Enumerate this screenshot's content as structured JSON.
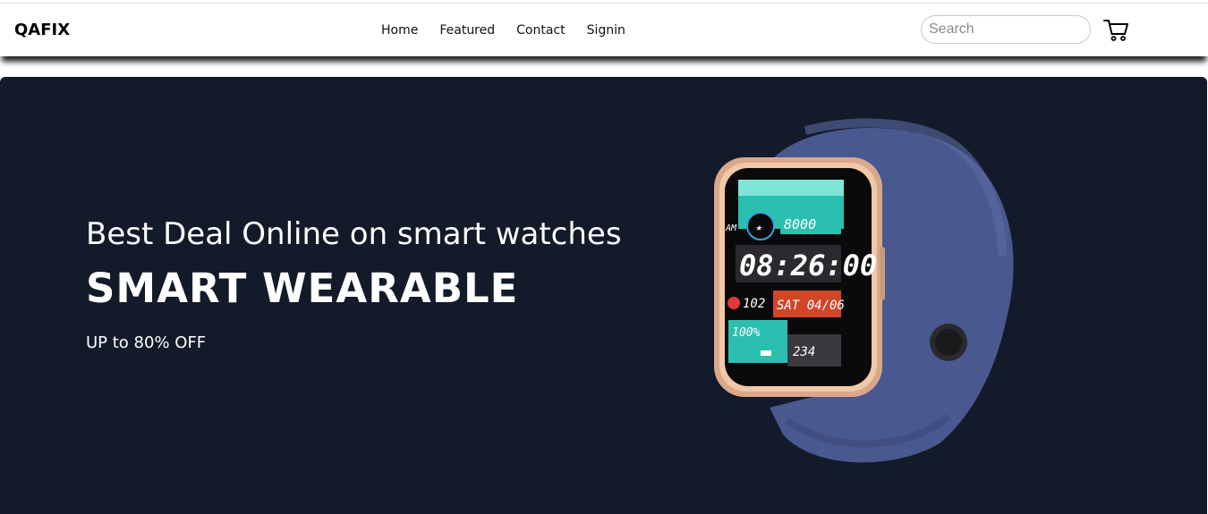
{
  "header": {
    "brand": "QAFIX",
    "nav": [
      {
        "label": "Home"
      },
      {
        "label": "Featured"
      },
      {
        "label": "Contact"
      },
      {
        "label": "Signin"
      }
    ],
    "search_placeholder": "Search",
    "cart_icon": "cart-icon"
  },
  "hero": {
    "subtitle": "Best Deal Online on smart watches",
    "title": "SMART WEARABLE",
    "offer": "UP to 80% OFF",
    "background": "#131a2a",
    "watch": {
      "time": "08:26:00",
      "steps": "8000",
      "am": "AM",
      "heart": "102",
      "date": "SAT 04/06",
      "battery": "100%",
      "calories": "234"
    }
  }
}
